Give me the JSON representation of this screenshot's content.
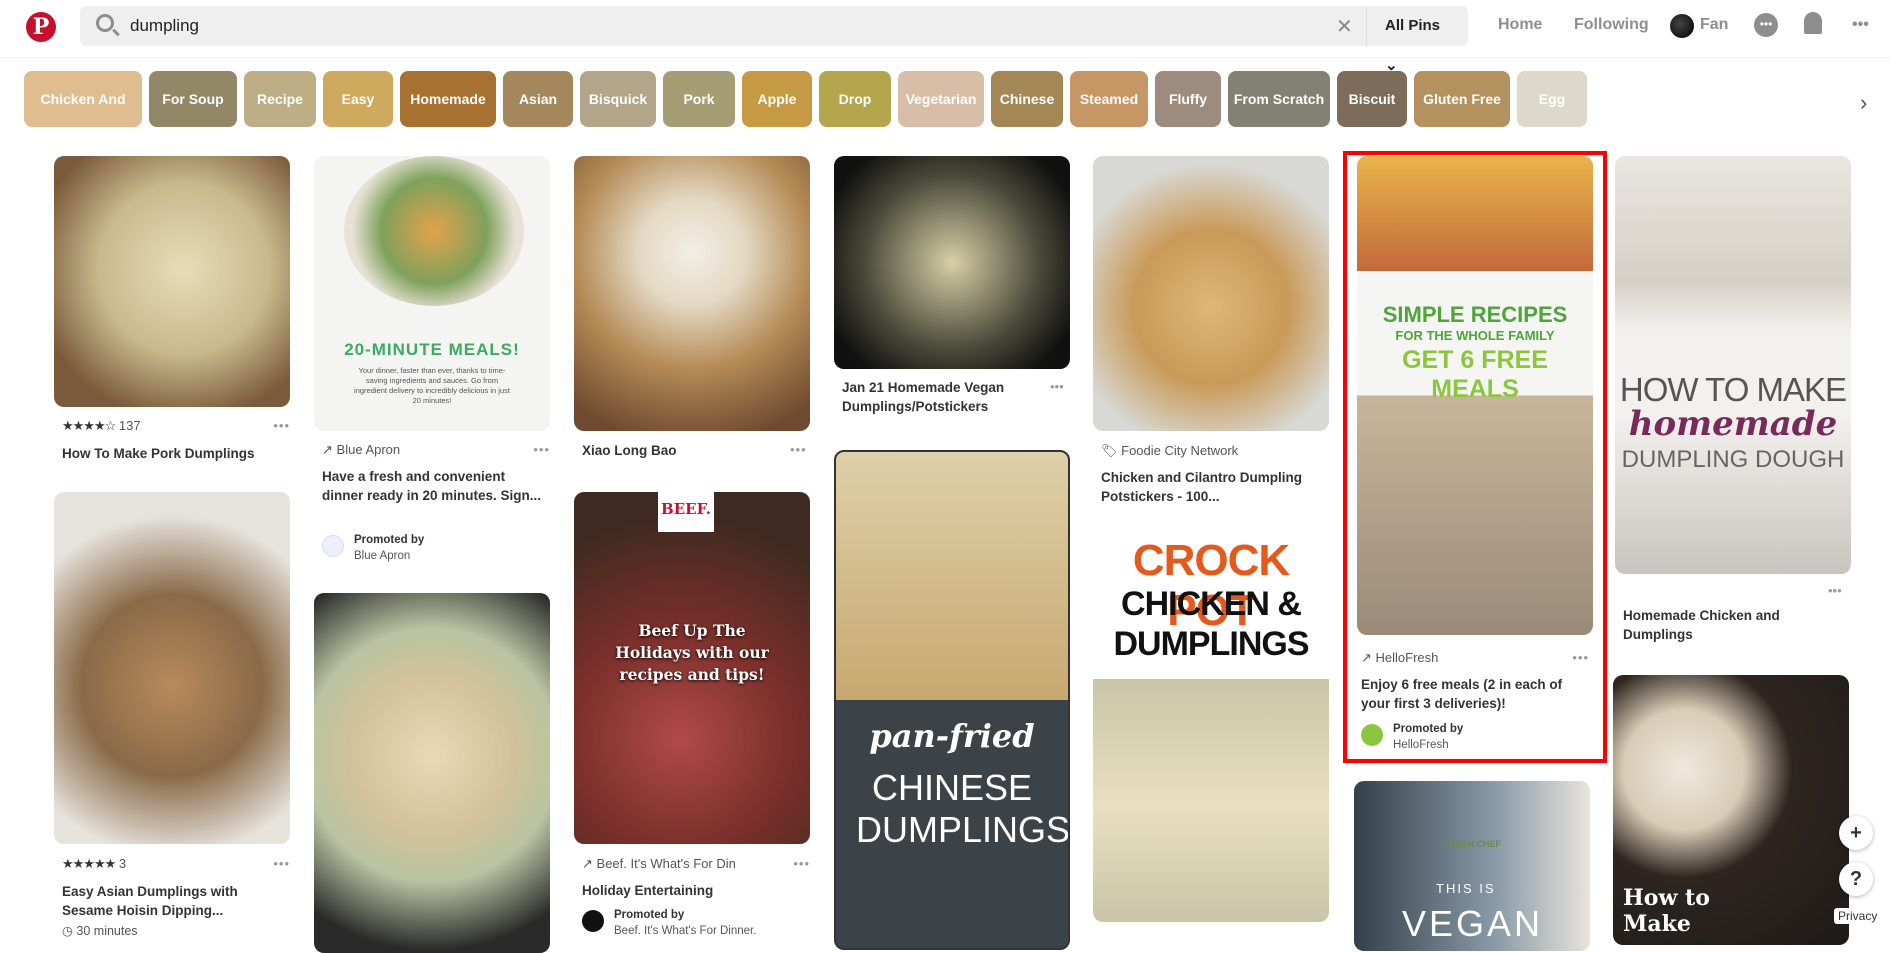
{
  "header": {
    "search_value": "dumpling",
    "filter": "All Pins",
    "nav": [
      "Home",
      "Following"
    ],
    "user": "Fan"
  },
  "chips": [
    {
      "label": "Chicken And",
      "color": "#dfbd8f"
    },
    {
      "label": "For Soup",
      "color": "#928868"
    },
    {
      "label": "Recipe",
      "color": "#bdae87"
    },
    {
      "label": "Easy",
      "color": "#cfa95d"
    },
    {
      "label": "Homemade",
      "color": "#a77231"
    },
    {
      "label": "Asian",
      "color": "#a4885b"
    },
    {
      "label": "Bisquick",
      "color": "#b2a58a"
    },
    {
      "label": "Pork",
      "color": "#a59e74"
    },
    {
      "label": "Apple",
      "color": "#c69a45"
    },
    {
      "label": "Drop",
      "color": "#b5a64e"
    },
    {
      "label": "Vegetarian",
      "color": "#d8bea6"
    },
    {
      "label": "Chinese",
      "color": "#a38856"
    },
    {
      "label": "Steamed",
      "color": "#c69765"
    },
    {
      "label": "Fluffy",
      "color": "#9d8b7e"
    },
    {
      "label": "From Scratch",
      "color": "#818273"
    },
    {
      "label": "Biscuit",
      "color": "#7d6c5a"
    },
    {
      "label": "Gluten Free",
      "color": "#b3925f"
    },
    {
      "label": "Egg",
      "color": "#ddd8cc"
    }
  ],
  "pins": {
    "p1": {
      "rating": "★★★★☆",
      "count": "137",
      "title": "How To Make Pork Dumplings"
    },
    "p2": {
      "rating": "★★★★★",
      "count": "3",
      "title": "Easy Asian Dumplings with Sesame Hoisin Dipping...",
      "time": "30 minutes"
    },
    "p3": {
      "source": "Blue Apron",
      "title": "Have a fresh and convenient dinner ready in 20 minutes. Sign...",
      "promoted": "Promoted by",
      "promoter": "Blue Apron",
      "overlay": "20-MINUTE MEALS!",
      "overlay_sub": "Your dinner, faster than ever, thanks to time-saving ingredients and sauces. Go from ingredient delivery to incredibly delicious in just 20 minutes!"
    },
    "p5": {
      "title": "Xiao Long Bao"
    },
    "p6": {
      "source": "Beef. It's What's For Din",
      "title": "Holiday Entertaining",
      "promoted": "Promoted by",
      "promoter": "Beef. It's What's For Dinner.",
      "overlay_logo": "BEEF.",
      "overlay": "Beef Up The Holidays with our recipes and tips!"
    },
    "p7": {
      "title": "Jan 21 Homemade Vegan Dumplings/Potstickers"
    },
    "p8": {
      "overlay1": "pan-fried",
      "overlay2": "CHINESE DUMPLINGS"
    },
    "p9": {
      "source": "Foodie City Network",
      "title": "Chicken and Cilantro Dumpling Potstickers - 100..."
    },
    "p10": {
      "overlay1": "CROCK POT",
      "overlay2": "CHICKEN & DUMPLINGS"
    },
    "p11": {
      "source": "HelloFresh",
      "title": "Enjoy 6 free meals (2 in each of your first 3 deliveries)!",
      "promoted": "Promoted by",
      "promoter": "HelloFresh",
      "overlay1": "SIMPLE RECIPES",
      "overlay2": "FOR THE WHOLE FAMILY",
      "overlay3": "GET 6 FREE MEALS",
      "highlight_color": "#ff0000"
    },
    "p12": {
      "overlay1": "GREEN CHEF",
      "overlay2": "THIS IS",
      "overlay3": "VEGAN"
    },
    "p13": {
      "title": "Homemade Chicken and Dumplings",
      "overlay1": "HOW TO MAKE",
      "overlay2": "homemade",
      "overlay3": "DUMPLING DOUGH"
    },
    "p14": {
      "overlay": "How to Make"
    }
  },
  "footer": {
    "privacy": "Privacy"
  }
}
